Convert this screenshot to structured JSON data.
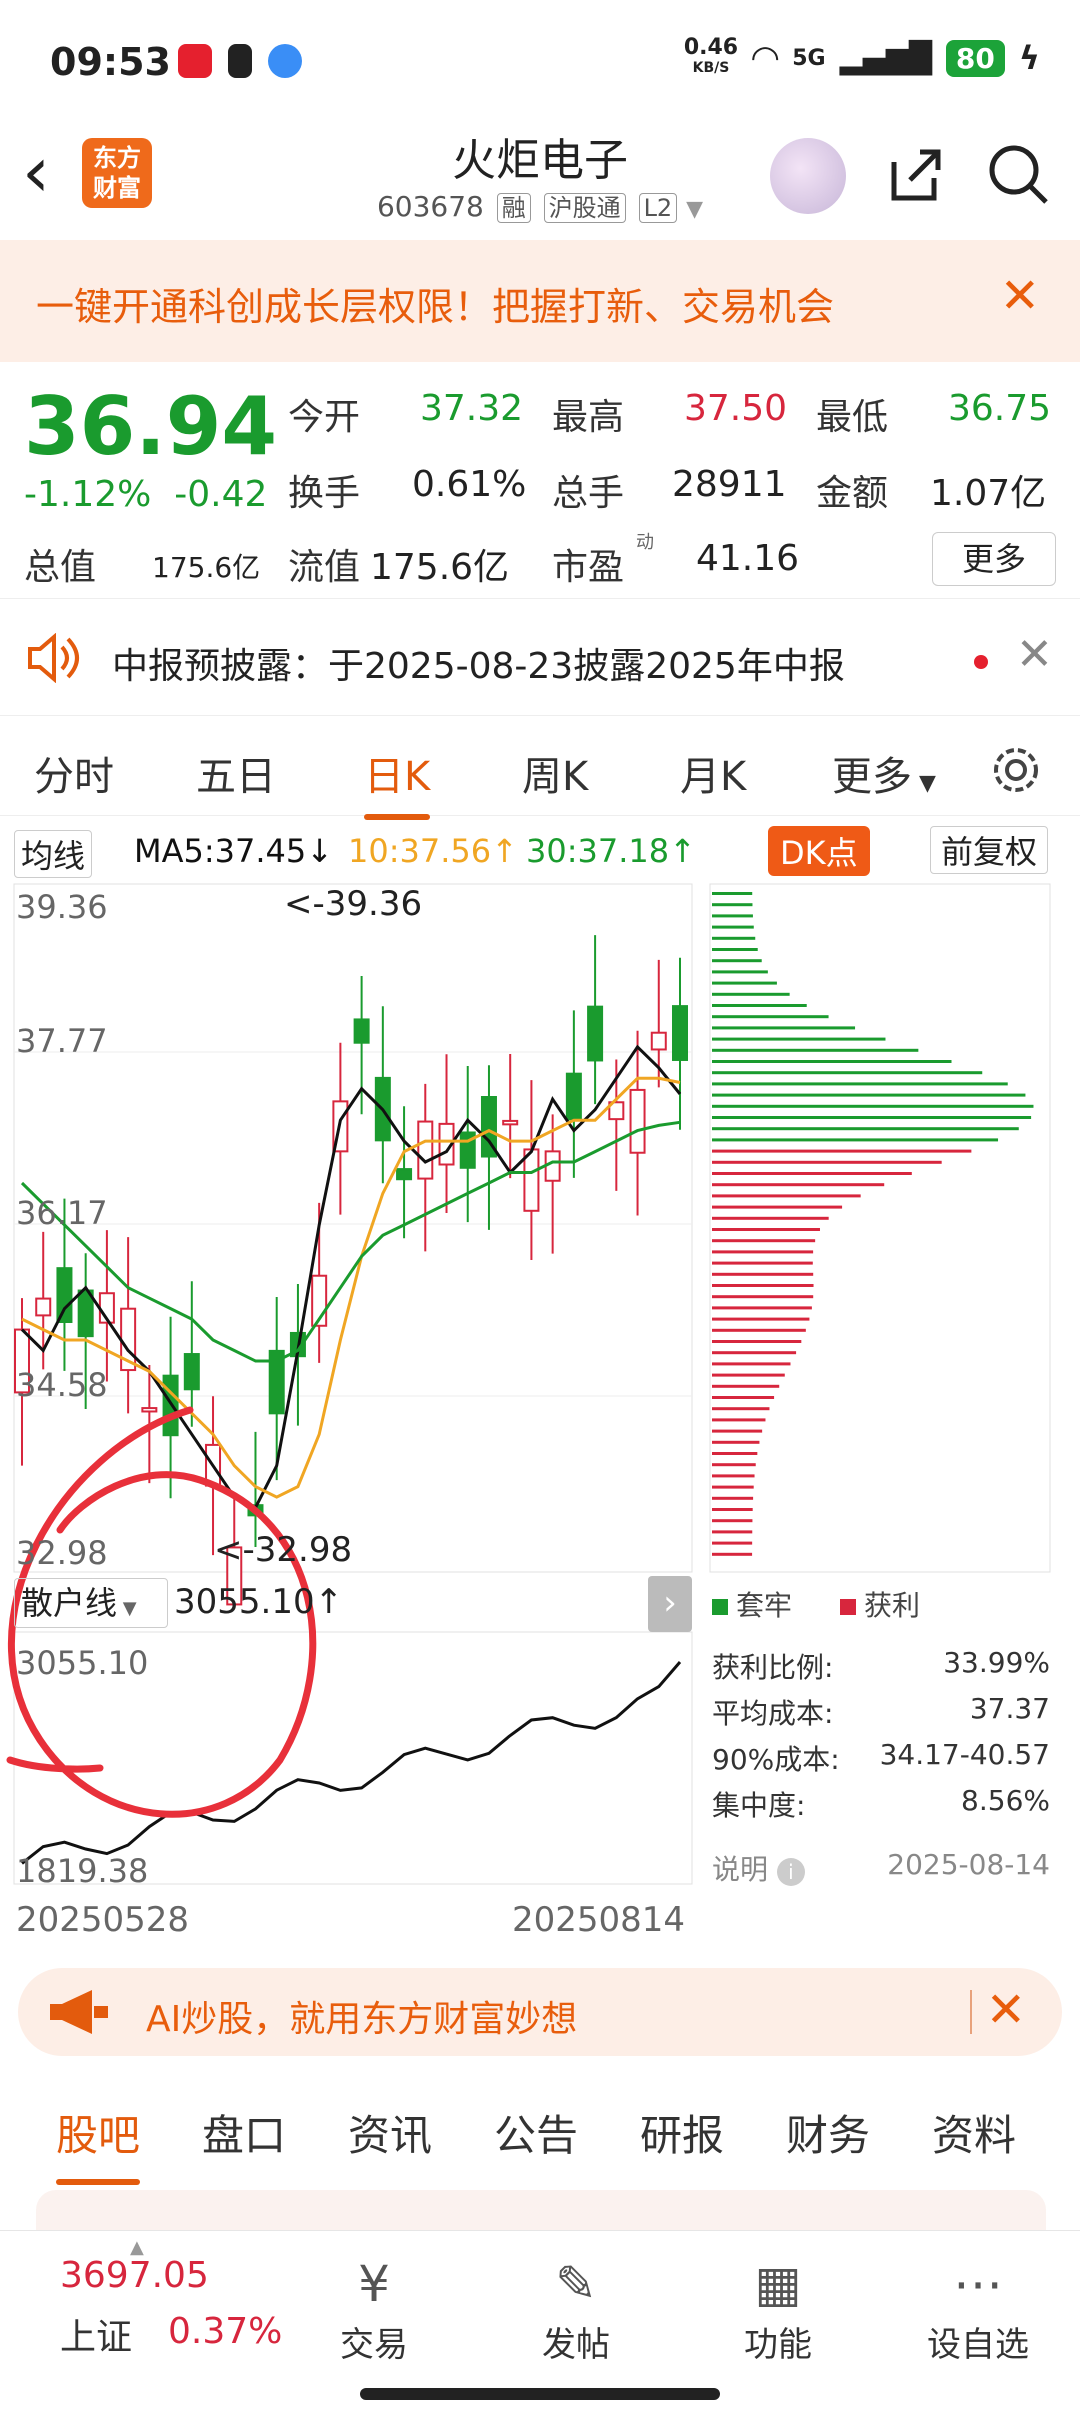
{
  "status": {
    "time": "09:53",
    "net_speed": "0.46",
    "net_unit": "KB/S",
    "signal": "5G",
    "battery": "80"
  },
  "header": {
    "logo": "东方\n财富",
    "title": "火炬电子",
    "code": "603678",
    "tags": [
      "融",
      "沪股通",
      "L2"
    ]
  },
  "banner": {
    "text": "一键开通科创成长层权限！把握打新、交易机会"
  },
  "quote": {
    "price": "36.94",
    "pct": "-1.12%",
    "chg": "-0.42",
    "open_label": "今开",
    "open": "37.32",
    "high_label": "最高",
    "high": "37.50",
    "low_label": "最低",
    "low": "36.75",
    "turnover_label": "换手",
    "turnover": "0.61%",
    "volume_label": "总手",
    "volume": "28911",
    "amount_label": "金额",
    "amount": "1.07亿",
    "mktcap_label": "总值",
    "mktcap": "175.6亿",
    "float_label": "流值",
    "float": "175.6亿",
    "pe_label": "市盈",
    "pe_sup": "动",
    "pe": "41.16",
    "more": "更多"
  },
  "notice": {
    "text": "中报预披露：于2025-08-23披露2025年中报"
  },
  "tabs": [
    "分时",
    "五日",
    "日K",
    "周K",
    "月K",
    "更多"
  ],
  "active_tab": "日K",
  "legend": {
    "selector": "均线",
    "ma5": "MA5:37.45↓",
    "ma10": "10:37.56↑",
    "ma30": "30:37.18↑",
    "dk": "DK点",
    "adjust": "前复权"
  },
  "kline": {
    "y_ticks": [
      "39.36",
      "37.77",
      "36.17",
      "34.58",
      "32.98"
    ],
    "high_marker": "<-39.36",
    "low_marker": "<-32.98",
    "sub_selector": "散户线",
    "sub_value": "3055.10↑",
    "sub_ticks": [
      "3055.10",
      "1819.38"
    ],
    "date_start": "20250528",
    "date_end": "20250814",
    "colors": {
      "up": "#d7263d",
      "down": "#1a9b2e",
      "ma5": "#111111",
      "ma10": "#f0a623",
      "ma30": "#1a9b2e"
    }
  },
  "chart_data": {
    "type": "candlestick",
    "title": "",
    "x_range": [
      "20250528",
      "20250814"
    ],
    "ylim": [
      32.98,
      39.36
    ],
    "series": [
      {
        "name": "MA5",
        "values": [
          35.2,
          35.0,
          35.4,
          35.6,
          35.3,
          35.0,
          34.8,
          34.5,
          34.2,
          33.9,
          33.6,
          33.5,
          33.9,
          35.0,
          36.2,
          37.2,
          37.5,
          37.3,
          37.0,
          36.8,
          36.9,
          37.2,
          37.0,
          36.7,
          36.9,
          37.4,
          37.1,
          37.3,
          37.6,
          37.9,
          37.7,
          37.45
        ]
      },
      {
        "name": "MA10",
        "values": [
          35.3,
          35.2,
          35.1,
          35.1,
          35.0,
          34.9,
          34.8,
          34.6,
          34.4,
          34.2,
          33.9,
          33.7,
          33.6,
          33.7,
          34.2,
          35.1,
          35.9,
          36.5,
          36.9,
          37.0,
          37.0,
          37.0,
          37.1,
          37.0,
          37.0,
          37.1,
          37.2,
          37.2,
          37.4,
          37.6,
          37.6,
          37.56
        ]
      },
      {
        "name": "MA30",
        "values": [
          36.6,
          36.4,
          36.2,
          36.0,
          35.8,
          35.6,
          35.5,
          35.4,
          35.3,
          35.1,
          35.0,
          34.9,
          34.9,
          35.0,
          35.3,
          35.6,
          35.9,
          36.1,
          36.2,
          36.3,
          36.4,
          36.5,
          36.6,
          36.7,
          36.7,
          36.8,
          36.8,
          36.9,
          37.0,
          37.1,
          37.15,
          37.18
        ]
      }
    ],
    "chips": {
      "profit_ratio": "33.99%",
      "avg_cost": "37.37",
      "cost_90": "34.17-40.57",
      "concentration": "8.56%",
      "date": "2025-08-14"
    }
  },
  "chips_panel": {
    "trapped": "套牢",
    "profit": "获利",
    "profit_ratio_label": "获利比例:",
    "avg_cost_label": "平均成本:",
    "cost_90_label": "90%成本:",
    "concentration_label": "集中度:",
    "explain": "说明"
  },
  "ai_bar": {
    "text": "AI炒股，就用东方财富妙想"
  },
  "subtabs": [
    "股吧",
    "盘口",
    "资讯",
    "公告",
    "研报",
    "财务",
    "资料"
  ],
  "bottom": {
    "index_value": "3697.05",
    "index_name": "上证",
    "index_pct": "0.37%",
    "items": [
      "交易",
      "发帖",
      "功能",
      "设自选"
    ]
  }
}
